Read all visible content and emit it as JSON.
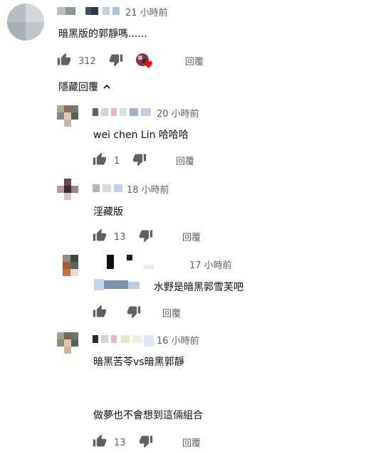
{
  "main_comment": {
    "time": "21 小時前",
    "text": "暗黑版的郭靜嗎......",
    "likes": "312",
    "reply_label": "回覆",
    "creator_heart": true
  },
  "toggle_label": "隱藏回覆",
  "replies": [
    {
      "time": "20 小時前",
      "text": "wei chen Lin 哈哈哈",
      "likes": "1",
      "reply_label": "回覆"
    },
    {
      "time": "18 小時前",
      "text": "淫藏版",
      "likes": "13",
      "reply_label": "回覆"
    },
    {
      "time": "17 小時前",
      "text": "水野是暗黑郭雪芙吧",
      "likes": "",
      "reply_label": "回覆"
    },
    {
      "time": "16 小時前",
      "text_lines": [
        "暗黑苦苓vs暗黑郭靜",
        "做夢也不會想到這倆組合"
      ],
      "likes": "13",
      "reply_label": "回覆"
    }
  ],
  "icons": {
    "like": "thumb-up-icon",
    "dislike": "thumb-down-icon",
    "heart": "heart-icon",
    "chevron": "chevron-up-icon"
  },
  "colors": {
    "text": "#0f0f0f",
    "secondary": "#606060",
    "heart": "#ff0000"
  }
}
